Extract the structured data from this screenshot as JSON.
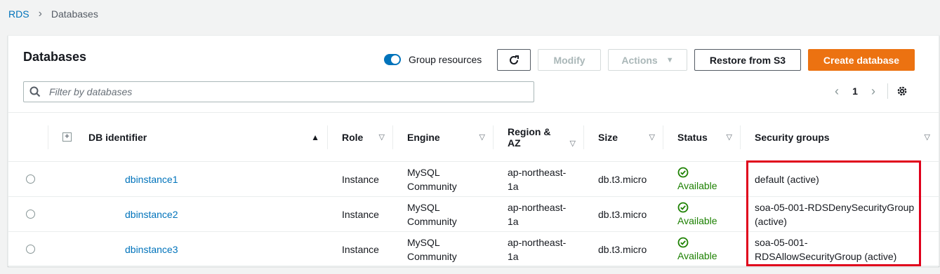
{
  "breadcrumb": {
    "root": "RDS",
    "current": "Databases"
  },
  "panel": {
    "title": "Databases"
  },
  "toolbar": {
    "group_resources_label": "Group resources",
    "modify_label": "Modify",
    "actions_label": "Actions",
    "restore_label": "Restore from S3",
    "create_label": "Create database"
  },
  "filter": {
    "placeholder": "Filter by databases"
  },
  "pagination": {
    "current_page": "1"
  },
  "table": {
    "headers": {
      "db_identifier": "DB identifier",
      "role": "Role",
      "engine": "Engine",
      "region_line1": "Region &",
      "region_line2": "AZ",
      "size": "Size",
      "status": "Status",
      "security_groups": "Security groups"
    },
    "rows": [
      {
        "id": "dbinstance1",
        "role": "Instance",
        "engine_l1": "MySQL",
        "engine_l2": "Community",
        "region_l1": "ap-northeast-",
        "region_l2": "1a",
        "size": "db.t3.micro",
        "status": "Available",
        "sg_l1": "default (active)",
        "sg_l2": ""
      },
      {
        "id": "dbinstance2",
        "role": "Instance",
        "engine_l1": "MySQL",
        "engine_l2": "Community",
        "region_l1": "ap-northeast-",
        "region_l2": "1a",
        "size": "db.t3.micro",
        "status": "Available",
        "sg_l1": "soa-05-001-RDSDenySecurityGroup",
        "sg_l2": "(active)"
      },
      {
        "id": "dbinstance3",
        "role": "Instance",
        "engine_l1": "MySQL",
        "engine_l2": "Community",
        "region_l1": "ap-northeast-",
        "region_l2": "1a",
        "size": "db.t3.micro",
        "status": "Available",
        "sg_l1": "soa-05-001-",
        "sg_l2": "RDSAllowSecurityGroup (active)"
      }
    ]
  },
  "colors": {
    "link": "#0073bb",
    "primary": "#ec7211",
    "success": "#1d8102",
    "highlight": "#e0001b"
  }
}
